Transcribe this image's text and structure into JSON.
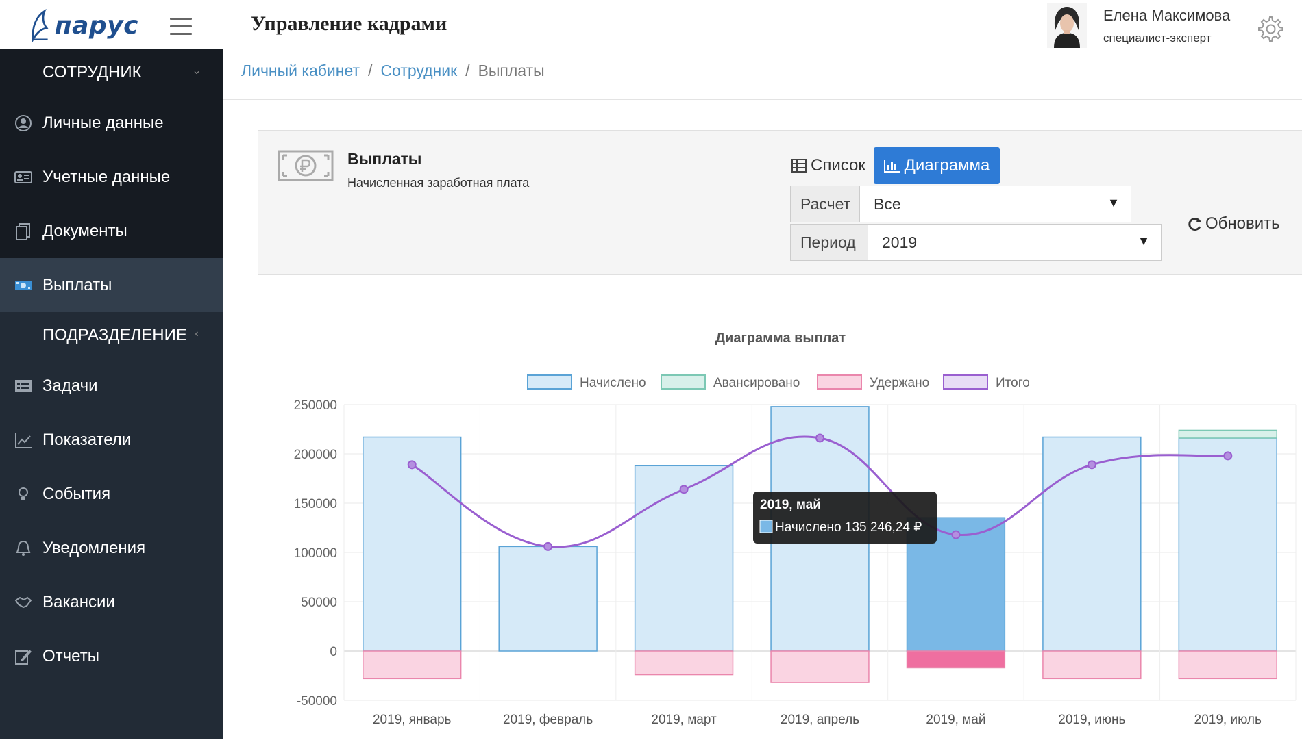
{
  "header": {
    "logo_text": "парус",
    "app_title": "Управление кадрами",
    "user_name": "Елена Максимова",
    "user_role": "специалист-эксперт"
  },
  "sidebar": {
    "section_employee": "СОТРУДНИК",
    "section_department": "ПОДРАЗДЕЛЕНИЕ",
    "employee_items": [
      {
        "label": "Личные данные",
        "icon": "user-circle-icon"
      },
      {
        "label": "Учетные данные",
        "icon": "id-card-icon"
      },
      {
        "label": "Документы",
        "icon": "documents-icon"
      },
      {
        "label": "Выплаты",
        "icon": "money-icon",
        "active": true
      }
    ],
    "items": [
      {
        "label": "Задачи",
        "icon": "tasks-icon"
      },
      {
        "label": "Показатели",
        "icon": "line-chart-icon"
      },
      {
        "label": "События",
        "icon": "lightbulb-icon"
      },
      {
        "label": "Уведомления",
        "icon": "bell-icon"
      },
      {
        "label": "Вакансии",
        "icon": "handshake-icon"
      },
      {
        "label": "Отчеты",
        "icon": "edit-icon"
      }
    ]
  },
  "breadcrumb": {
    "items": [
      "Личный кабинет",
      "Сотрудник"
    ],
    "current": "Выплаты",
    "separator": "/"
  },
  "panel": {
    "title": "Выплаты",
    "subtitle": "Начисленная заработная плата",
    "btn_list": "Список",
    "btn_chart": "Диаграмма",
    "calc_label": "Расчет",
    "calc_value": "Все",
    "period_label": "Период",
    "period_value": "2019",
    "refresh": "Обновить"
  },
  "colors": {
    "accent": "#2e7bd6",
    "sidebar_bg": "#222b36",
    "accrued_fill": "#d6eaf8",
    "accrued_stroke": "#5aa3d6",
    "advance_fill": "#d8f0ea",
    "advance_stroke": "#7cc8b4",
    "withheld_fill": "#fad4e2",
    "withheld_stroke": "#ea86ac",
    "total_line": "#9a5fd0"
  },
  "chart_data": {
    "type": "bar",
    "title": "Диаграмма выплат",
    "categories": [
      "2019, январь",
      "2019, февраль",
      "2019, март",
      "2019, апрель",
      "2019, май",
      "2019, июнь",
      "2019, июль"
    ],
    "ylim": [
      -50000,
      250000
    ],
    "yticks": [
      250000,
      200000,
      150000,
      100000,
      50000,
      0,
      -50000
    ],
    "legend_position": "top",
    "series": [
      {
        "name": "Начислено",
        "type": "bar",
        "values": [
          217000,
          106000,
          188000,
          248000,
          135246.24,
          217000,
          216000
        ]
      },
      {
        "name": "Авансировано",
        "type": "bar",
        "values": [
          0,
          0,
          0,
          0,
          0,
          0,
          8000
        ]
      },
      {
        "name": "Удержано",
        "type": "bar",
        "values": [
          -28000,
          0,
          -24000,
          -32000,
          -17000,
          -28000,
          -28000
        ]
      },
      {
        "name": "Итого",
        "type": "line",
        "values": [
          189000,
          106000,
          164000,
          216000,
          118000,
          189000,
          198000
        ]
      }
    ],
    "tooltip": {
      "title": "2019, май",
      "text": "Начислено 135 246,24 ₽",
      "category_index": 4
    }
  }
}
